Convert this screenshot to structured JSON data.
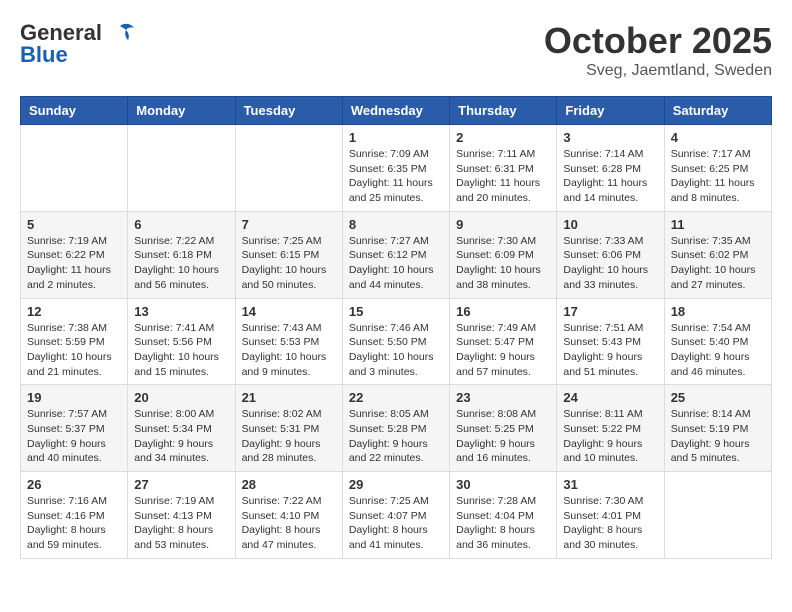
{
  "logo": {
    "general": "General",
    "blue": "Blue"
  },
  "header": {
    "month": "October 2025",
    "location": "Sveg, Jaemtland, Sweden"
  },
  "weekdays": [
    "Sunday",
    "Monday",
    "Tuesday",
    "Wednesday",
    "Thursday",
    "Friday",
    "Saturday"
  ],
  "weeks": [
    [
      {
        "day": "",
        "info": ""
      },
      {
        "day": "",
        "info": ""
      },
      {
        "day": "",
        "info": ""
      },
      {
        "day": "1",
        "info": "Sunrise: 7:09 AM\nSunset: 6:35 PM\nDaylight: 11 hours\nand 25 minutes."
      },
      {
        "day": "2",
        "info": "Sunrise: 7:11 AM\nSunset: 6:31 PM\nDaylight: 11 hours\nand 20 minutes."
      },
      {
        "day": "3",
        "info": "Sunrise: 7:14 AM\nSunset: 6:28 PM\nDaylight: 11 hours\nand 14 minutes."
      },
      {
        "day": "4",
        "info": "Sunrise: 7:17 AM\nSunset: 6:25 PM\nDaylight: 11 hours\nand 8 minutes."
      }
    ],
    [
      {
        "day": "5",
        "info": "Sunrise: 7:19 AM\nSunset: 6:22 PM\nDaylight: 11 hours\nand 2 minutes."
      },
      {
        "day": "6",
        "info": "Sunrise: 7:22 AM\nSunset: 6:18 PM\nDaylight: 10 hours\nand 56 minutes."
      },
      {
        "day": "7",
        "info": "Sunrise: 7:25 AM\nSunset: 6:15 PM\nDaylight: 10 hours\nand 50 minutes."
      },
      {
        "day": "8",
        "info": "Sunrise: 7:27 AM\nSunset: 6:12 PM\nDaylight: 10 hours\nand 44 minutes."
      },
      {
        "day": "9",
        "info": "Sunrise: 7:30 AM\nSunset: 6:09 PM\nDaylight: 10 hours\nand 38 minutes."
      },
      {
        "day": "10",
        "info": "Sunrise: 7:33 AM\nSunset: 6:06 PM\nDaylight: 10 hours\nand 33 minutes."
      },
      {
        "day": "11",
        "info": "Sunrise: 7:35 AM\nSunset: 6:02 PM\nDaylight: 10 hours\nand 27 minutes."
      }
    ],
    [
      {
        "day": "12",
        "info": "Sunrise: 7:38 AM\nSunset: 5:59 PM\nDaylight: 10 hours\nand 21 minutes."
      },
      {
        "day": "13",
        "info": "Sunrise: 7:41 AM\nSunset: 5:56 PM\nDaylight: 10 hours\nand 15 minutes."
      },
      {
        "day": "14",
        "info": "Sunrise: 7:43 AM\nSunset: 5:53 PM\nDaylight: 10 hours\nand 9 minutes."
      },
      {
        "day": "15",
        "info": "Sunrise: 7:46 AM\nSunset: 5:50 PM\nDaylight: 10 hours\nand 3 minutes."
      },
      {
        "day": "16",
        "info": "Sunrise: 7:49 AM\nSunset: 5:47 PM\nDaylight: 9 hours\nand 57 minutes."
      },
      {
        "day": "17",
        "info": "Sunrise: 7:51 AM\nSunset: 5:43 PM\nDaylight: 9 hours\nand 51 minutes."
      },
      {
        "day": "18",
        "info": "Sunrise: 7:54 AM\nSunset: 5:40 PM\nDaylight: 9 hours\nand 46 minutes."
      }
    ],
    [
      {
        "day": "19",
        "info": "Sunrise: 7:57 AM\nSunset: 5:37 PM\nDaylight: 9 hours\nand 40 minutes."
      },
      {
        "day": "20",
        "info": "Sunrise: 8:00 AM\nSunset: 5:34 PM\nDaylight: 9 hours\nand 34 minutes."
      },
      {
        "day": "21",
        "info": "Sunrise: 8:02 AM\nSunset: 5:31 PM\nDaylight: 9 hours\nand 28 minutes."
      },
      {
        "day": "22",
        "info": "Sunrise: 8:05 AM\nSunset: 5:28 PM\nDaylight: 9 hours\nand 22 minutes."
      },
      {
        "day": "23",
        "info": "Sunrise: 8:08 AM\nSunset: 5:25 PM\nDaylight: 9 hours\nand 16 minutes."
      },
      {
        "day": "24",
        "info": "Sunrise: 8:11 AM\nSunset: 5:22 PM\nDaylight: 9 hours\nand 10 minutes."
      },
      {
        "day": "25",
        "info": "Sunrise: 8:14 AM\nSunset: 5:19 PM\nDaylight: 9 hours\nand 5 minutes."
      }
    ],
    [
      {
        "day": "26",
        "info": "Sunrise: 7:16 AM\nSunset: 4:16 PM\nDaylight: 8 hours\nand 59 minutes."
      },
      {
        "day": "27",
        "info": "Sunrise: 7:19 AM\nSunset: 4:13 PM\nDaylight: 8 hours\nand 53 minutes."
      },
      {
        "day": "28",
        "info": "Sunrise: 7:22 AM\nSunset: 4:10 PM\nDaylight: 8 hours\nand 47 minutes."
      },
      {
        "day": "29",
        "info": "Sunrise: 7:25 AM\nSunset: 4:07 PM\nDaylight: 8 hours\nand 41 minutes."
      },
      {
        "day": "30",
        "info": "Sunrise: 7:28 AM\nSunset: 4:04 PM\nDaylight: 8 hours\nand 36 minutes."
      },
      {
        "day": "31",
        "info": "Sunrise: 7:30 AM\nSunset: 4:01 PM\nDaylight: 8 hours\nand 30 minutes."
      },
      {
        "day": "",
        "info": ""
      }
    ]
  ]
}
